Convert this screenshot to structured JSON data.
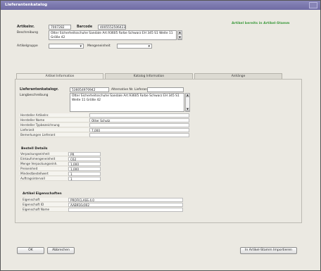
{
  "window": {
    "title": "Lieferantenkatalog"
  },
  "header": {
    "artikelnr_label": "Artikelnr.",
    "artikelnr_value": "7007282",
    "barcode_label": "Barcode",
    "barcode_value": "4005552506423",
    "beschreibung_label": "Beschreibung",
    "beschreibung_value": "Otter Sicherheitsschuhe Sandale  Art.93605 Farbe Schwarz EH 345 S1 Weite 11 Größe 42",
    "artikelgruppe_label": "Artikelgruppe",
    "mengeneinheit_label": "Mengeneinheit",
    "status_text": "Artikel bereits in Artikel-Stamm"
  },
  "tabs": [
    {
      "label": "Artikel Information"
    },
    {
      "label": "Katalog Information"
    },
    {
      "label": "Anhänge"
    }
  ],
  "panel": {
    "lieferantenkatalog_label": "Lieferantenkatalogr.",
    "lieferantenkatalog_value": "536054970942",
    "alt_lieferant_label": "Alternative Nr. Lieferant",
    "langbeschreibung_label": "Langbeschreibung",
    "langbeschreibung_value": "Otter Sicherheitsschuhe Sandale  Art.93605 Farbe Schwarz EH 345 S1  Weite 11 Größe 42",
    "rows": [
      {
        "label": "Hersteller Artikelnr.",
        "value": ""
      },
      {
        "label": "Hersteller Name",
        "value": "Otter Schutz"
      },
      {
        "label": "Hersteller Typbezeichnung",
        "value": ""
      },
      {
        "label": "Lieferzeit",
        "value": "7,000"
      },
      {
        "label": "Bemerkungen Lieferant",
        "value": ""
      }
    ],
    "bestell_title": "Bestell Details",
    "bestell_rows": [
      {
        "label": "Verpackungseinheit",
        "value": "PR"
      },
      {
        "label": "Einkaufsmengeneinheit",
        "value": "C62"
      },
      {
        "label": "Menge  Verpackungseinh.",
        "value": "1,000"
      },
      {
        "label": "Preiseinheit",
        "value": "1,000"
      },
      {
        "label": "Mindestbestellwert",
        "value": "1"
      },
      {
        "label": "Auftragsintervall",
        "value": "1"
      }
    ],
    "eigen_title": "Artikel Eigenschaften",
    "eigen_rows": [
      {
        "label": "Eigenschaft",
        "value": "PROFICLASS 4.0"
      },
      {
        "label": "Eigenschaft ID",
        "value": "AAB916c002"
      },
      {
        "label": "Eigenschaft Name",
        "value": ""
      }
    ]
  },
  "footer": {
    "ok_label": "OK",
    "cancel_label": "Abbrechen",
    "import_label": "In Artikel-Stamm Importieren"
  }
}
